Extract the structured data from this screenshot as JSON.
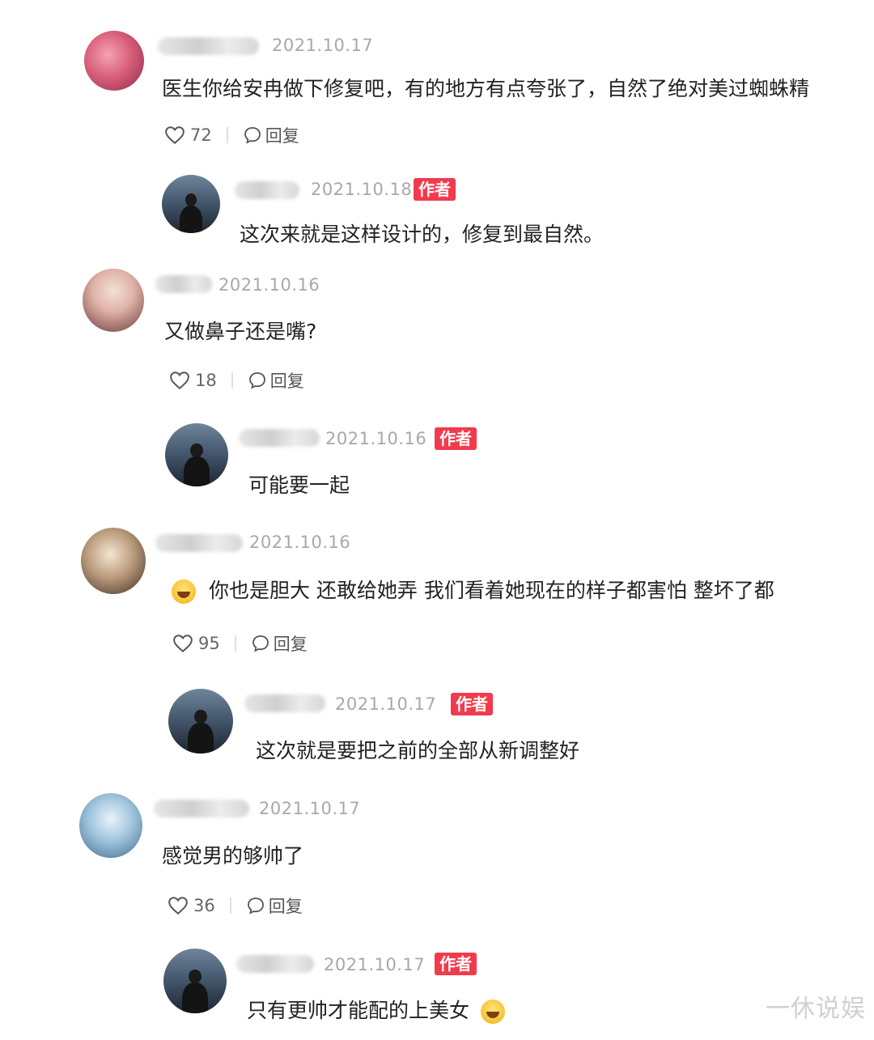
{
  "comments": [
    {
      "date": "2021.10.17",
      "text": "医生你给安冉做下修复吧，有的地方有点夸张了，自然了绝对美过蜘蛛精",
      "likes": "72",
      "reply_label": "回复",
      "reply": {
        "date": "2021.10.18",
        "badge": "作者",
        "text": "这次来就是这样设计的，修复到最自然。"
      }
    },
    {
      "date": "2021.10.16",
      "text": "又做鼻子还是嘴?",
      "likes": "18",
      "reply_label": "回复",
      "reply": {
        "date": "2021.10.16",
        "badge": "作者",
        "text": "可能要一起"
      }
    },
    {
      "date": "2021.10.16",
      "text": "你也是胆大 还敢给她弄 我们看着她现在的样子都害怕 整坏了都",
      "likes": "95",
      "reply_label": "回复",
      "reply": {
        "date": "2021.10.17",
        "badge": "作者",
        "text": "这次就是要把之前的全部从新调整好"
      }
    },
    {
      "date": "2021.10.17",
      "text": "感觉男的够帅了",
      "likes": "36",
      "reply_label": "回复",
      "reply": {
        "date": "2021.10.17",
        "badge": "作者",
        "text": "只有更帅才能配的上美女"
      }
    }
  ],
  "watermark": "一休说娱",
  "icons": {
    "like": "heart-outline-icon",
    "reply": "speech-bubble-icon",
    "emoji_laugh": "laughing-emoji-icon",
    "emoji_grin": "grinning-emoji-icon"
  },
  "colors": {
    "badge": "#f23a4d",
    "date": "#a8a8a8",
    "text": "#222222"
  }
}
